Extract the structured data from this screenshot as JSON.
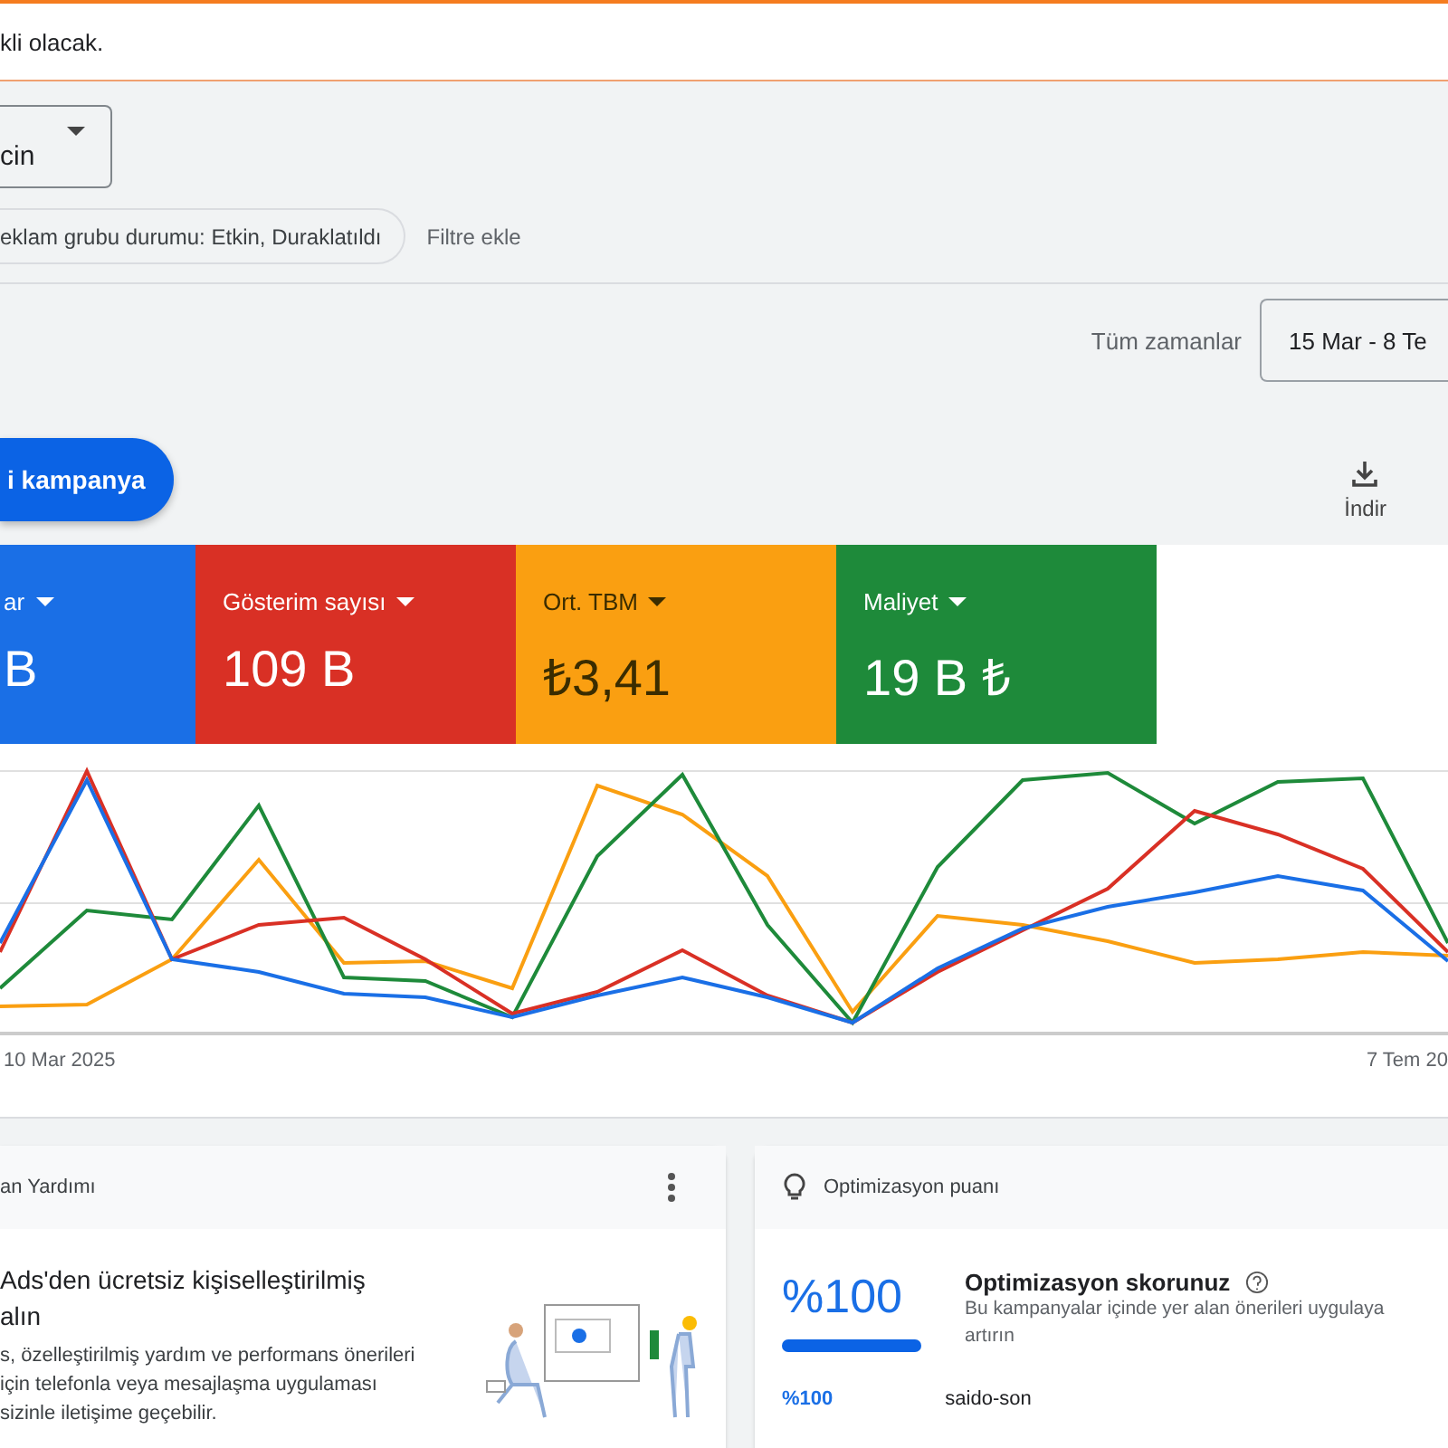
{
  "banner": {
    "text": "kli olacak."
  },
  "selector": {
    "value": "cin"
  },
  "filters": {
    "chip": "eklam grubu durumu: Etkin, Duraklatıldı",
    "add_filter": "Filtre ekle"
  },
  "date_range": {
    "label": "Tüm zamanlar",
    "value": "15 Mar - 8 Te"
  },
  "new_campaign_button": "i kampanya",
  "download": {
    "label": "İndir"
  },
  "metrics": [
    {
      "label": "ar",
      "value": "B",
      "color": "#1a6fe6"
    },
    {
      "label": "Gösterim sayısı",
      "value": "109 B",
      "color": "#d93025"
    },
    {
      "label": "Ort. TBM",
      "value": "₺3,41",
      "color": "#fa9f11"
    },
    {
      "label": "Maliyet",
      "value": "19 B ₺",
      "color": "#1e8a3a"
    }
  ],
  "chart": {
    "x_start": "10 Mar 2025",
    "x_end": "7 Tem 20"
  },
  "help_card": {
    "header": "an Yardımı",
    "title_lines": [
      "Ads'den ücretsiz kişiselleştirilmiş",
      "alın"
    ],
    "body_lines": [
      "s, özelleştirilmiş yardım ve performans önerileri",
      "için telefonla veya mesajlaşma uygulaması",
      "sizinle iletişime geçebilir."
    ]
  },
  "optimization_card": {
    "header": "Optimizasyon puanı",
    "score": "%100",
    "level": 1,
    "title": "Optimizasyon skorunuz",
    "description_lines": [
      "Bu kampanyalar içinde yer alan önerileri uygulaya",
      "artırın"
    ],
    "rows": [
      {
        "score": "%100",
        "name": "saido-son"
      }
    ]
  }
}
